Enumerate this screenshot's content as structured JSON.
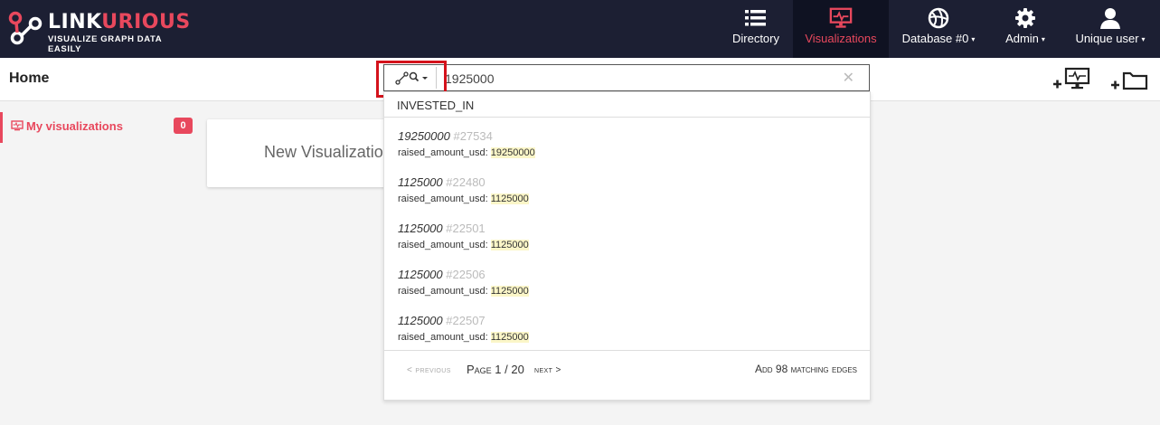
{
  "brand": {
    "name_part1": "LINK",
    "name_part2": "URIOUS",
    "tagline": "VISUALIZE GRAPH DATA EASILY",
    "accent_color": "#e8485d",
    "nav_bg": "#1c1f33"
  },
  "nav": {
    "directory": "Directory",
    "visualizations": "Visualizations",
    "database": "Database #0",
    "admin": "Admin",
    "user": "Unique user"
  },
  "header": {
    "title": "Home",
    "search_value": "1925000",
    "search_mode_icon": "edge-search-icon"
  },
  "sidebar": {
    "item_label": "My visualizations",
    "item_count": "0"
  },
  "main": {
    "new_viz_label": "New Visualization"
  },
  "dropdown": {
    "type_label": "INVESTED_IN",
    "results": [
      {
        "value": "19250000",
        "id": "#27534",
        "prop": "raised_amount_usd:",
        "prop_value": "19250000"
      },
      {
        "value": "1125000",
        "id": "#22480",
        "prop": "raised_amount_usd:",
        "prop_value": "1125000"
      },
      {
        "value": "1125000",
        "id": "#22501",
        "prop": "raised_amount_usd:",
        "prop_value": "1125000"
      },
      {
        "value": "1125000",
        "id": "#22506",
        "prop": "raised_amount_usd:",
        "prop_value": "1125000"
      },
      {
        "value": "1125000",
        "id": "#22507",
        "prop": "raised_amount_usd:",
        "prop_value": "1125000"
      }
    ],
    "pagination": {
      "prev": "< previous",
      "page_info": "Page 1 / 20",
      "next": "next >",
      "add_label": "Add 98 matching edges"
    }
  }
}
